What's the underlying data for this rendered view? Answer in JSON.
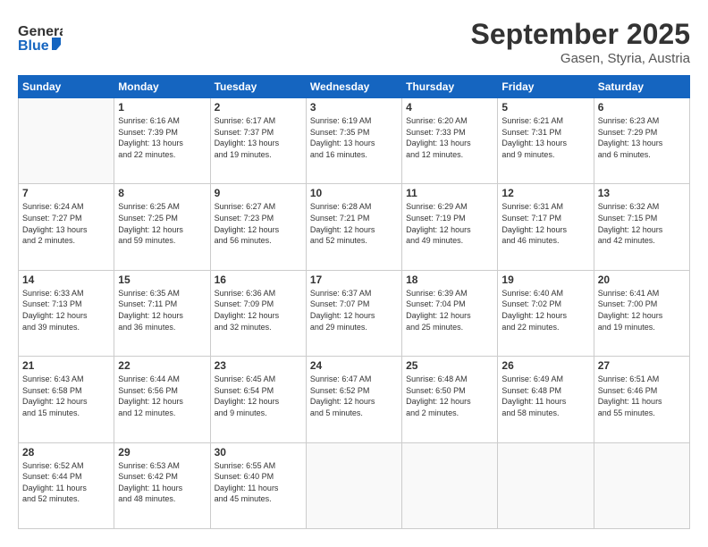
{
  "header": {
    "logo_general": "General",
    "logo_blue": "Blue",
    "month_title": "September 2025",
    "location": "Gasen, Styria, Austria"
  },
  "weekdays": [
    "Sunday",
    "Monday",
    "Tuesday",
    "Wednesday",
    "Thursday",
    "Friday",
    "Saturday"
  ],
  "weeks": [
    [
      {
        "day": "",
        "info": ""
      },
      {
        "day": "1",
        "info": "Sunrise: 6:16 AM\nSunset: 7:39 PM\nDaylight: 13 hours\nand 22 minutes."
      },
      {
        "day": "2",
        "info": "Sunrise: 6:17 AM\nSunset: 7:37 PM\nDaylight: 13 hours\nand 19 minutes."
      },
      {
        "day": "3",
        "info": "Sunrise: 6:19 AM\nSunset: 7:35 PM\nDaylight: 13 hours\nand 16 minutes."
      },
      {
        "day": "4",
        "info": "Sunrise: 6:20 AM\nSunset: 7:33 PM\nDaylight: 13 hours\nand 12 minutes."
      },
      {
        "day": "5",
        "info": "Sunrise: 6:21 AM\nSunset: 7:31 PM\nDaylight: 13 hours\nand 9 minutes."
      },
      {
        "day": "6",
        "info": "Sunrise: 6:23 AM\nSunset: 7:29 PM\nDaylight: 13 hours\nand 6 minutes."
      }
    ],
    [
      {
        "day": "7",
        "info": "Sunrise: 6:24 AM\nSunset: 7:27 PM\nDaylight: 13 hours\nand 2 minutes."
      },
      {
        "day": "8",
        "info": "Sunrise: 6:25 AM\nSunset: 7:25 PM\nDaylight: 12 hours\nand 59 minutes."
      },
      {
        "day": "9",
        "info": "Sunrise: 6:27 AM\nSunset: 7:23 PM\nDaylight: 12 hours\nand 56 minutes."
      },
      {
        "day": "10",
        "info": "Sunrise: 6:28 AM\nSunset: 7:21 PM\nDaylight: 12 hours\nand 52 minutes."
      },
      {
        "day": "11",
        "info": "Sunrise: 6:29 AM\nSunset: 7:19 PM\nDaylight: 12 hours\nand 49 minutes."
      },
      {
        "day": "12",
        "info": "Sunrise: 6:31 AM\nSunset: 7:17 PM\nDaylight: 12 hours\nand 46 minutes."
      },
      {
        "day": "13",
        "info": "Sunrise: 6:32 AM\nSunset: 7:15 PM\nDaylight: 12 hours\nand 42 minutes."
      }
    ],
    [
      {
        "day": "14",
        "info": "Sunrise: 6:33 AM\nSunset: 7:13 PM\nDaylight: 12 hours\nand 39 minutes."
      },
      {
        "day": "15",
        "info": "Sunrise: 6:35 AM\nSunset: 7:11 PM\nDaylight: 12 hours\nand 36 minutes."
      },
      {
        "day": "16",
        "info": "Sunrise: 6:36 AM\nSunset: 7:09 PM\nDaylight: 12 hours\nand 32 minutes."
      },
      {
        "day": "17",
        "info": "Sunrise: 6:37 AM\nSunset: 7:07 PM\nDaylight: 12 hours\nand 29 minutes."
      },
      {
        "day": "18",
        "info": "Sunrise: 6:39 AM\nSunset: 7:04 PM\nDaylight: 12 hours\nand 25 minutes."
      },
      {
        "day": "19",
        "info": "Sunrise: 6:40 AM\nSunset: 7:02 PM\nDaylight: 12 hours\nand 22 minutes."
      },
      {
        "day": "20",
        "info": "Sunrise: 6:41 AM\nSunset: 7:00 PM\nDaylight: 12 hours\nand 19 minutes."
      }
    ],
    [
      {
        "day": "21",
        "info": "Sunrise: 6:43 AM\nSunset: 6:58 PM\nDaylight: 12 hours\nand 15 minutes."
      },
      {
        "day": "22",
        "info": "Sunrise: 6:44 AM\nSunset: 6:56 PM\nDaylight: 12 hours\nand 12 minutes."
      },
      {
        "day": "23",
        "info": "Sunrise: 6:45 AM\nSunset: 6:54 PM\nDaylight: 12 hours\nand 9 minutes."
      },
      {
        "day": "24",
        "info": "Sunrise: 6:47 AM\nSunset: 6:52 PM\nDaylight: 12 hours\nand 5 minutes."
      },
      {
        "day": "25",
        "info": "Sunrise: 6:48 AM\nSunset: 6:50 PM\nDaylight: 12 hours\nand 2 minutes."
      },
      {
        "day": "26",
        "info": "Sunrise: 6:49 AM\nSunset: 6:48 PM\nDaylight: 11 hours\nand 58 minutes."
      },
      {
        "day": "27",
        "info": "Sunrise: 6:51 AM\nSunset: 6:46 PM\nDaylight: 11 hours\nand 55 minutes."
      }
    ],
    [
      {
        "day": "28",
        "info": "Sunrise: 6:52 AM\nSunset: 6:44 PM\nDaylight: 11 hours\nand 52 minutes."
      },
      {
        "day": "29",
        "info": "Sunrise: 6:53 AM\nSunset: 6:42 PM\nDaylight: 11 hours\nand 48 minutes."
      },
      {
        "day": "30",
        "info": "Sunrise: 6:55 AM\nSunset: 6:40 PM\nDaylight: 11 hours\nand 45 minutes."
      },
      {
        "day": "",
        "info": ""
      },
      {
        "day": "",
        "info": ""
      },
      {
        "day": "",
        "info": ""
      },
      {
        "day": "",
        "info": ""
      }
    ]
  ]
}
